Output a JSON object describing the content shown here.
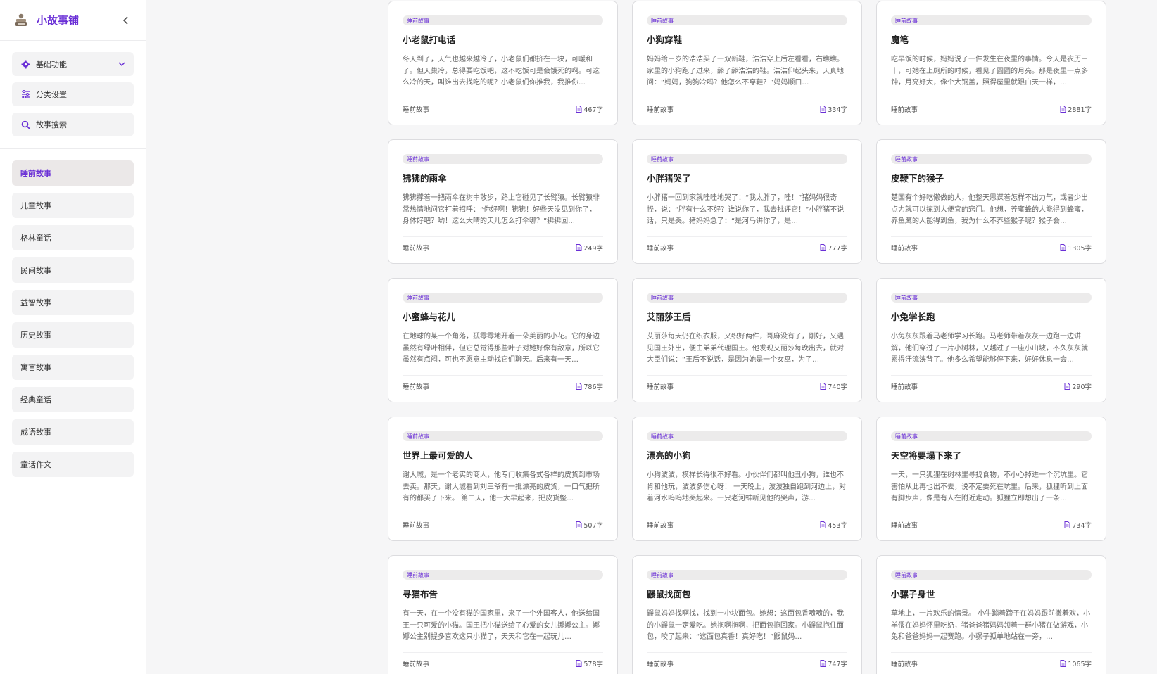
{
  "app": {
    "title": "小故事铺"
  },
  "colors": {
    "accent": "#6a2fd6",
    "card_bg": "#ffffff",
    "page_bg": "#f6f6f7"
  },
  "functions": [
    {
      "label": "基础功能",
      "icon": "gear-icon",
      "expandable": true
    },
    {
      "label": "分类设置",
      "icon": "sliders-icon",
      "expandable": false
    },
    {
      "label": "故事搜索",
      "icon": "search-icon",
      "expandable": false
    }
  ],
  "categories": [
    {
      "label": "睡前故事",
      "active": true
    },
    {
      "label": "儿童故事"
    },
    {
      "label": "格林童话"
    },
    {
      "label": "民间故事"
    },
    {
      "label": "益智故事"
    },
    {
      "label": "历史故事"
    },
    {
      "label": "寓言故事"
    },
    {
      "label": "经典童话"
    },
    {
      "label": "成语故事"
    },
    {
      "label": "童话作文"
    }
  ],
  "stories": [
    {
      "tag": "睡前故事",
      "title": "小老鼠打电话",
      "excerpt": "冬天到了，天气也越来越冷了，小老鼠们都挤在一块，可暖和了。但天巢冷，总得要吃饭吧，这不吃饭可是会饿死的啊。可这么冷的天，叫谁出去找吃的呢？小老鼠们你推我，我推你…",
      "category": "睡前故事",
      "count": "467字"
    },
    {
      "tag": "睡前故事",
      "title": "小狗穿鞋",
      "excerpt": "妈妈给三岁的浩浩买了一双新鞋，浩浩穿上后左看看，右瞧瞧。家里的小狗跑了过来，舔了舔浩浩的鞋。浩浩仰起头来，天真地问：“妈妈，狗狗冷吗？他怎么不穿鞋？”妈妈顺口…",
      "category": "睡前故事",
      "count": "334字"
    },
    {
      "tag": "睡前故事",
      "title": "魔笔",
      "excerpt": "吃早饭的时候，妈妈说了一件发生在夜里的事情。今天是农历三十，可她在上厕所的时候，看见了圆圆的月亮。那是夜里一点多钟，月亮好大，像个大铜盖，照得屋里就跟白天一样，…",
      "category": "睡前故事",
      "count": "2881字"
    },
    {
      "tag": "睡前故事",
      "title": "狒狒的雨伞",
      "excerpt": "狒狒撑着一把雨伞在树中散步，路上它碰见了长臂猿。长臂猿非常热情地问它打着招呼：“你好啊！狒狒！好些天没见到你了，身体好吧？哟！这么大晴的天儿怎么打伞哪？”狒狒回…",
      "category": "睡前故事",
      "count": "249字"
    },
    {
      "tag": "睡前故事",
      "title": "小胖猪哭了",
      "excerpt": "小胖猪一回到家就哇哇地哭了：“我太胖了，哇！”猪妈妈很奇怪，说：“胖有什么不好？谁说你了，我去批评它！”小胖猪不说话，只是哭。猪妈妈急了：“是河马讲你了，是…",
      "category": "睡前故事",
      "count": "777字"
    },
    {
      "tag": "睡前故事",
      "title": "皮鞭下的猴子",
      "excerpt": "楚国有个好吃懒做的人，他整天思谋着怎样不出力气，或者少出点力就可以拣到大便宜的窍门。他想，养蜜蜂的人能得到蜂蜜，养鱼鹰的人能得到鱼，我为什么不养些猴子呢？猴子会…",
      "category": "睡前故事",
      "count": "1305字"
    },
    {
      "tag": "睡前故事",
      "title": "小蜜蜂与花儿",
      "excerpt": "在地球的某一个角落，孤零零地开着一朵美丽的小花。它的身边虽然有绿叶相伴，但它总觉得那些叶子对她好像有敌意，所以它虽然有点闷，可也不愿意主动找它们聊天。后来有一天…",
      "category": "睡前故事",
      "count": "786字"
    },
    {
      "tag": "睡前故事",
      "title": "艾丽莎王后",
      "excerpt": "艾丽莎每天仍在织衣服，又织好两件，哥麻没有了，刚好，又遇见国王外出，便由弟弟代理国王。他发现艾丽莎每晚出去，就对大臣们说：“王后不说话，是因为她是一个女巫，为了…",
      "category": "睡前故事",
      "count": "740字"
    },
    {
      "tag": "睡前故事",
      "title": "小兔学长跑",
      "excerpt": "小兔灰灰跟着马老师学习长跑。马老师带着灰灰一边跑一边讲解，他们穿过了一片小树林，又越过了一座小山坡，不久灰灰就累得汗流浃背了。他多么希望能够停下来，好好休息一会…",
      "category": "睡前故事",
      "count": "290字"
    },
    {
      "tag": "睡前故事",
      "title": "世界上最可爱的人",
      "excerpt": "谢大城，是一个老实的商人，他专门收集各式各样的皮货到市场去卖。那天，谢大城看到刘三爷有一批漂亮的皮货，一口气把所有的都买了下来。 第二天，他一大早起来，把皮货整…",
      "category": "睡前故事",
      "count": "507字"
    },
    {
      "tag": "睡前故事",
      "title": "漂亮的小狗",
      "excerpt": "小狗波波，模样长得很不好看。小伙伴们都叫他丑小狗，谁也不肯和他玩，波波多伤心呀！ 一天晚上，波波独自跑到河边上，对着河水呜呜地哭起来。一只老河蚌听见他的哭声，游…",
      "category": "睡前故事",
      "count": "453字"
    },
    {
      "tag": "睡前故事",
      "title": "天空将要塌下来了",
      "excerpt": "一天，一只狐狸在树林里寻找食物，不小心掉进一个沉坑里。它害怕从此再也出不去，说不定要死在坑里。后来，狐狸听到上面有脚步声，像是有人在附近走动。狐狸立即想出了一条…",
      "category": "睡前故事",
      "count": "734字"
    },
    {
      "tag": "睡前故事",
      "title": "寻猫布告",
      "excerpt": "有一天，在一个没有猫的国家里，来了一个外国客人，他送给国王一只可爱的小猫。国王把小猫送给了心爱的女儿娜娜公主。娜娜公主别提多喜欢这只小猫了，天天和它在一起玩儿…",
      "category": "睡前故事",
      "count": "578字"
    },
    {
      "tag": "睡前故事",
      "title": "鼹鼠找面包",
      "excerpt": "鼹鼠妈妈找啊找，找到一小块面包。她想：这面包香喷喷的，我的小鼹鼠一定爱吃。她拖啊拖啊，把面包拖回家。小鼹鼠抱住面包，咬了起来：“这面包真香！真好吃！”鼹鼠妈…",
      "category": "睡前故事",
      "count": "747字"
    },
    {
      "tag": "睡前故事",
      "title": "小骡子身世",
      "excerpt": "草地上，一片欢乐的情景。 小牛蹦着蹄子在妈妈跟前撒着欢，小羊偎在妈妈怀里吃奶，猪爸爸猪妈妈领着一群小猪在做游戏，小兔和爸爸妈妈一起赛跑。小骡子孤单地站在一旁，…",
      "category": "睡前故事",
      "count": "1065字"
    }
  ]
}
